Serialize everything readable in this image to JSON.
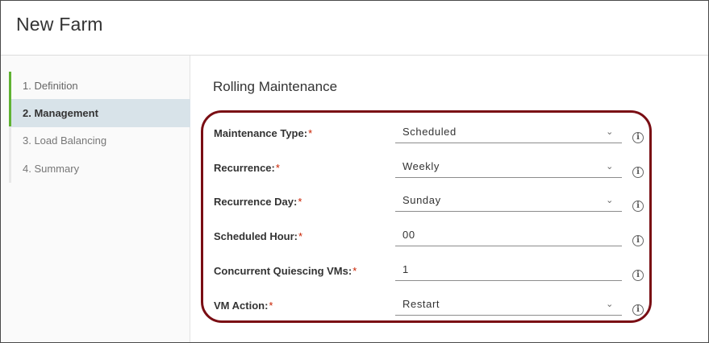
{
  "window": {
    "title": "New Farm"
  },
  "steps": [
    {
      "label": "1. Definition",
      "state": "done"
    },
    {
      "label": "2. Management",
      "state": "active"
    },
    {
      "label": "3. Load Balancing",
      "state": "pending"
    },
    {
      "label": "4. Summary",
      "state": "pending"
    }
  ],
  "section": {
    "title": "Rolling Maintenance"
  },
  "required_mark": "*",
  "form": {
    "maintenance_type": {
      "label": "Maintenance Type:",
      "value": "Scheduled",
      "control": "select"
    },
    "recurrence": {
      "label": "Recurrence:",
      "value": "Weekly",
      "control": "select"
    },
    "recurrence_day": {
      "label": "Recurrence Day:",
      "value": "Sunday",
      "control": "select"
    },
    "scheduled_hour": {
      "label": "Scheduled Hour:",
      "value": "00",
      "control": "input"
    },
    "concurrent_quiescing_vms": {
      "label": "Concurrent Quiescing VMs:",
      "value": "1",
      "control": "input"
    },
    "vm_action": {
      "label": "VM Action:",
      "value": "Restart",
      "control": "select"
    }
  },
  "icons": {
    "dropdown": "chevron-down-icon",
    "info": "info-icon"
  },
  "colors": {
    "active_step_bg": "#d8e3e9",
    "step_accent": "#5fb232",
    "required": "#c92100",
    "highlight_border": "#7a0e14"
  }
}
